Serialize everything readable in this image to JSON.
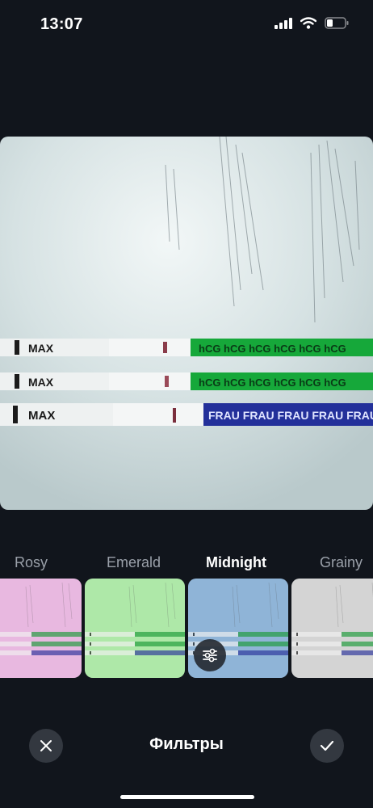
{
  "status_bar": {
    "time": "13:07",
    "icons": [
      "cellular-signal-icon",
      "wifi-icon",
      "battery-icon"
    ]
  },
  "photo": {
    "strips": [
      {
        "handle_text": "MAX",
        "band_text": "hCG hCG hCG hCG hCG hCG",
        "band_color": "#16a83a"
      },
      {
        "handle_text": "MAX",
        "band_text": "hCG hCG hCG hCG hCG hCG",
        "band_color": "#16a83a"
      },
      {
        "handle_text": "MAX",
        "band_text": "FRAU FRAU FRAU FRAU FRAU",
        "band_color": "#23309a"
      }
    ]
  },
  "filters": {
    "items": [
      {
        "label": "Rosy",
        "tint": "#e8b8e0"
      },
      {
        "label": "Emerald",
        "tint": "#aee8a8"
      },
      {
        "label": "Midnight",
        "tint": "#8fb4d8"
      },
      {
        "label": "Grainy",
        "tint": "#d4d4d4"
      }
    ],
    "selected": "Midnight"
  },
  "bottom_bar": {
    "title": "Фильтры",
    "cancel_icon": "close-icon",
    "confirm_icon": "checkmark-icon",
    "adjust_icon": "sliders-icon"
  },
  "colors": {
    "background": "#11151c",
    "button_background": "#333840",
    "inactive_label": "#9aa0a9"
  }
}
